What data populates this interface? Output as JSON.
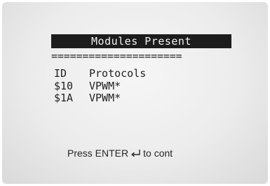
{
  "screen": {
    "title": "Modules Present",
    "divider": "=====================",
    "table": {
      "headers": {
        "id": "ID",
        "protocols": "Protocols"
      },
      "rows": [
        {
          "id": "$10",
          "protocol": "VPWM*"
        },
        {
          "id": "$1A",
          "protocol": "VPWM*"
        }
      ]
    },
    "footer": {
      "prefix": "Press ENTER",
      "icon": "enter-return-icon",
      "suffix": "to cont"
    }
  },
  "colors": {
    "title_bg": "#1c1c1c",
    "title_fg": "#f2f2f2",
    "text": "#222222",
    "screen_bg": "#ececec"
  }
}
